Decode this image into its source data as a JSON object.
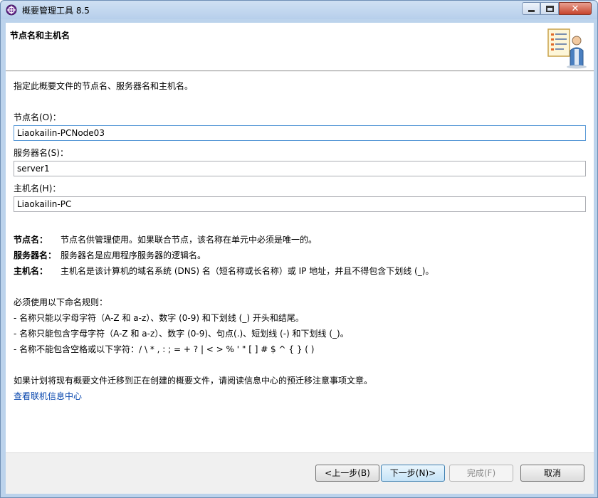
{
  "window": {
    "title": "概要管理工具 8.5",
    "close_glyph": "✕"
  },
  "banner": {
    "title": "节点名和主机名"
  },
  "content": {
    "intro": "指定此概要文件的节点名、服务器名和主机名。",
    "fields": [
      {
        "label": "节点名(O)：",
        "value": "Liaokailin-PCNode03"
      },
      {
        "label": "服务器名(S)：",
        "value": "server1"
      },
      {
        "label": "主机名(H)：",
        "value": "Liaokailin-PC"
      }
    ],
    "definitions": [
      {
        "term": "节点名：",
        "desc": "节点名供管理使用。如果联合节点，该名称在单元中必须是唯一的。"
      },
      {
        "term": "服务器名：",
        "desc": "服务器名是应用程序服务器的逻辑名。"
      },
      {
        "term": "主机名：",
        "desc": "主机名是该计算机的域名系统 (DNS) 名（短名称或长名称）或 IP 地址，并且不得包含下划线 (_)。"
      }
    ],
    "rules_heading": "必须使用以下命名规则：",
    "rules": [
      "-  名称只能以字母字符（A-Z 和 a-z）、数字 (0-9) 和下划线 (_) 开头和结尾。",
      "-  名称只能包含字母字符（A-Z 和 a-z）、数字 (0-9)、句点(.)、短划线 (-) 和下划线 (_)。",
      "-  名称不能包含空格或以下字符：/ \\ * , : ; = + ? | < >  % ' \" [ ] # $ ^ { } ( )"
    ],
    "migration_note": "如果计划将现有概要文件迁移到正在创建的概要文件，请阅读信息中心的预迁移注意事项文章。",
    "link": "查看联机信息中心"
  },
  "buttons": {
    "back": "<上一步(B)",
    "next": "下一步(N)>",
    "finish": "完成(F)",
    "cancel": "取消"
  }
}
